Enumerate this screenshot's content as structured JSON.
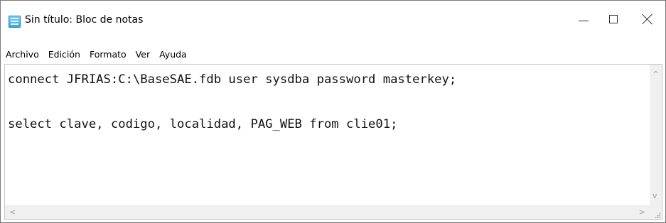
{
  "window": {
    "title": "Sin título: Bloc de notas",
    "app_icon": "notepad-icon",
    "controls": {
      "minimize_icon": "minimize-icon",
      "maximize_icon": "maximize-icon",
      "close_icon": "close-icon"
    }
  },
  "menu": {
    "items": [
      {
        "label": "Archivo"
      },
      {
        "label": "Edición"
      },
      {
        "label": "Formato"
      },
      {
        "label": "Ver"
      },
      {
        "label": "Ayuda"
      }
    ]
  },
  "editor": {
    "content": "connect JFRIAS:C:\\BaseSAE.fdb user sysdba password masterkey;\n\nselect clave, codigo, localidad, PAG_WEB from clie01;"
  },
  "scrollbars": {
    "up_arrow": "^",
    "down_arrow": "v",
    "left_arrow": "<",
    "right_arrow": ">"
  }
}
